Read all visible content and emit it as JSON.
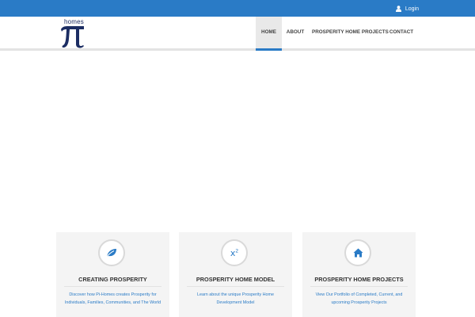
{
  "topbar": {
    "login_label": "Login",
    "login_icon": "user-icon"
  },
  "logo": {
    "text": "homes",
    "symbol": "π"
  },
  "nav": {
    "items": [
      {
        "label": "HOME",
        "active": true
      },
      {
        "label": "ABOUT",
        "active": false
      },
      {
        "label": "PROSPERITY HOME PROJECTS",
        "active": false
      },
      {
        "label": "CONTACT",
        "active": false
      }
    ]
  },
  "cards": [
    {
      "icon": "leaf-icon",
      "title": "CREATING PROSPERITY",
      "description": "Discover how Pi-Homes creates Prosperity for Individuals, Families, Communities, and The World"
    },
    {
      "icon": "x-squared-icon",
      "icon_text": "x",
      "icon_sup": "2",
      "title": "PROSPERITY HOME MODEL",
      "description": "Learn about the unique Prosperity Home Development Model"
    },
    {
      "icon": "home-icon",
      "title": "PROSPERITY HOME PROJECTS",
      "description": "View Our Portfolio of Completed, Current, and upcoming Prosperity Projects"
    }
  ],
  "colors": {
    "accent": "#2a7bc6",
    "logo": "#1c2d63",
    "card_bg": "#f4f4f4"
  }
}
